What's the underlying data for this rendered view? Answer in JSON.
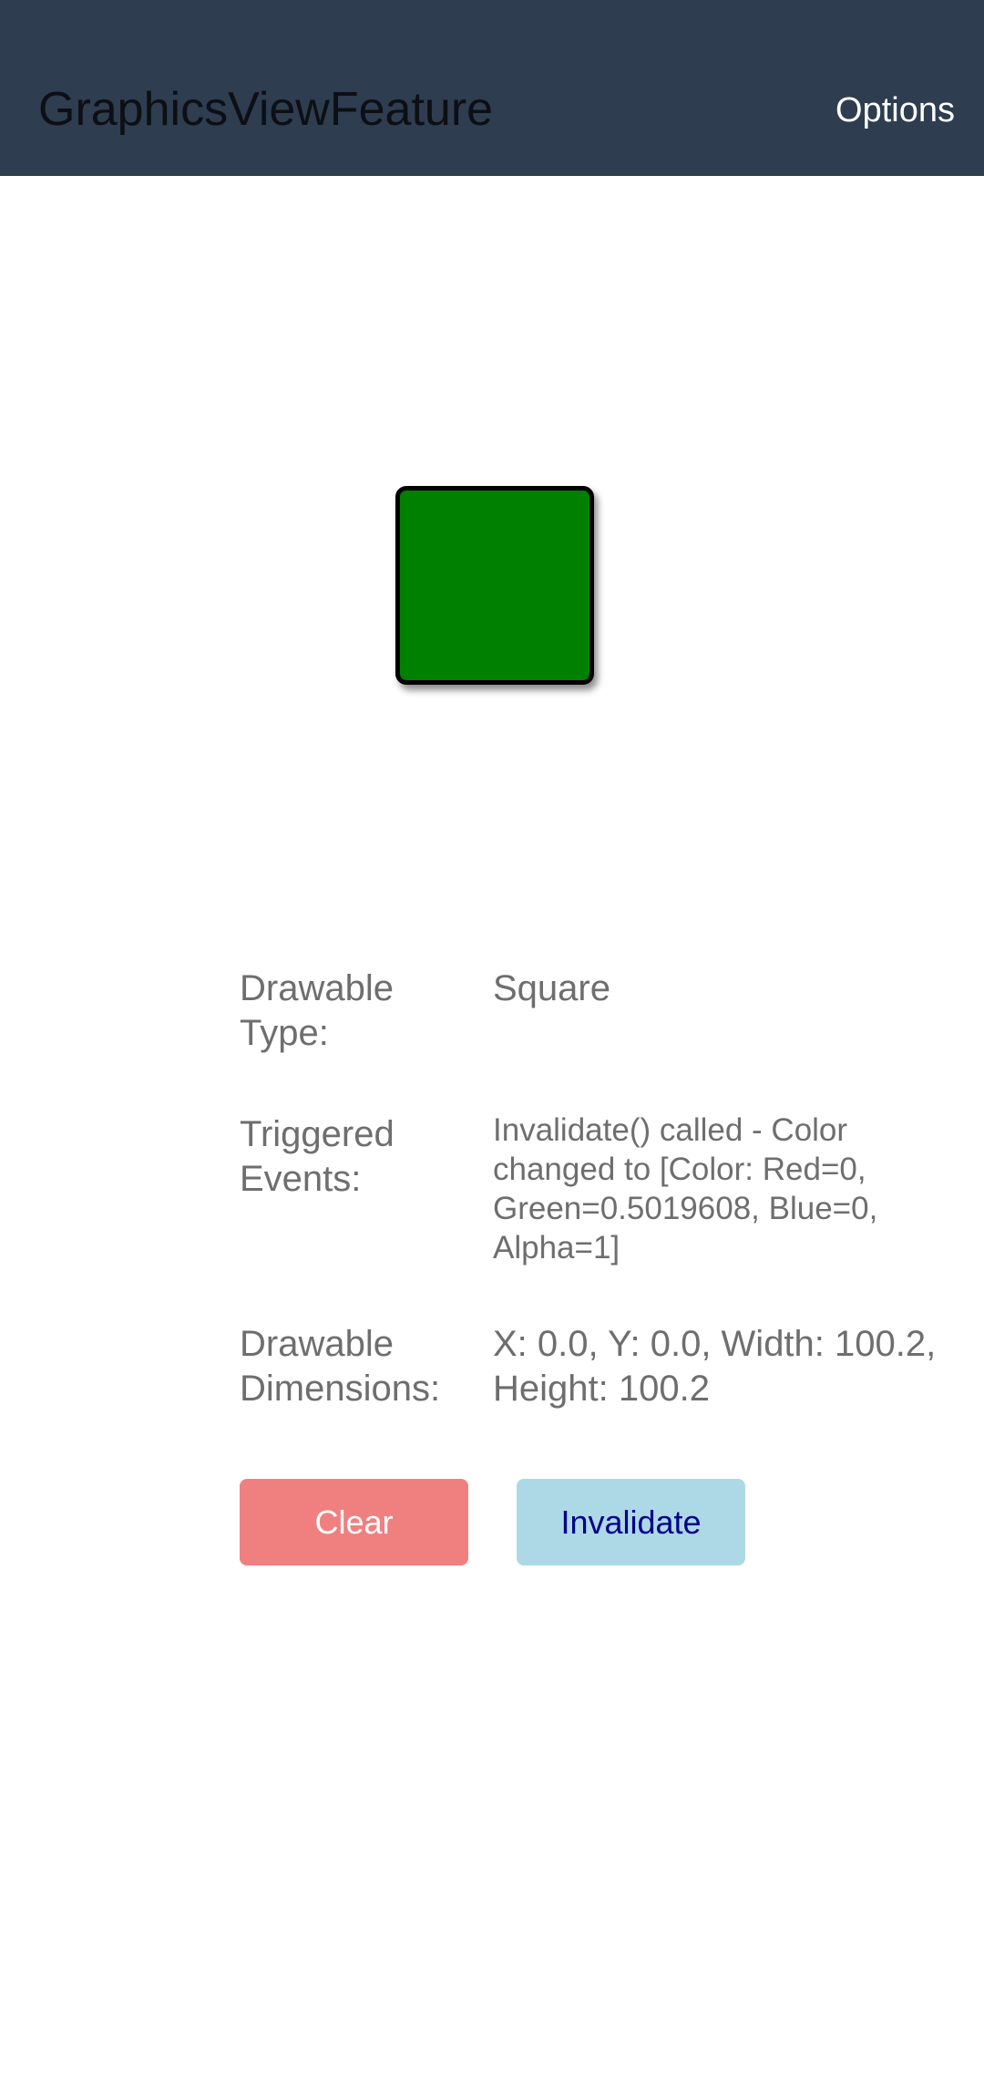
{
  "header": {
    "title": "GraphicsViewFeature",
    "options_label": "Options"
  },
  "drawable": {
    "shape": "square",
    "fill_color": "#008000",
    "stroke_color": "#000000"
  },
  "info": {
    "type_label": "Drawable Type:",
    "type_value": "Square",
    "events_label": "Triggered Events:",
    "events_value": "Invalidate() called - Color changed to [Color: Red=0, Green=0.5019608, Blue=0, Alpha=1]",
    "dimensions_label": "Drawable Dimensions:",
    "dimensions_value": "X: 0.0, Y: 0.0, Width: 100.2, Height: 100.2"
  },
  "buttons": {
    "clear_label": "Clear",
    "clear_color": "#f08080",
    "invalidate_label": "Invalidate",
    "invalidate_color": "#add8e6"
  },
  "colors": {
    "toolbar_bg": "#2e3d50",
    "text_gray": "#6e6e6e"
  }
}
